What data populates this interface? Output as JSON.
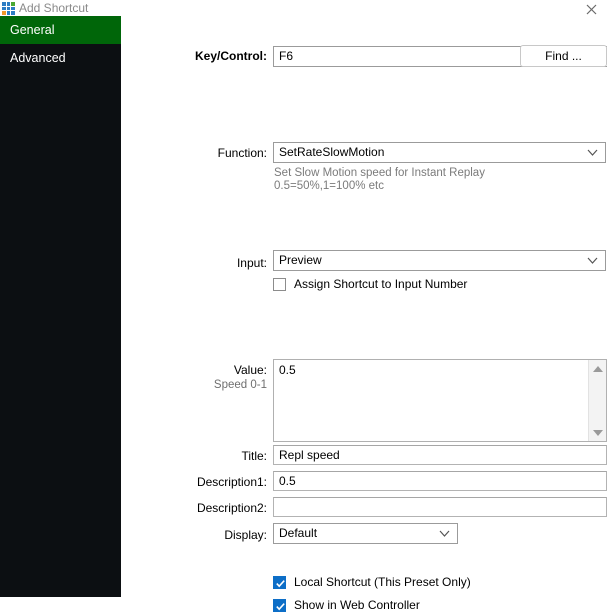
{
  "window": {
    "title": "Add Shortcut",
    "icon": "app-grid-icon",
    "close_label": "✕",
    "icon_colors": [
      "#2d7dc4",
      "#2d7dc4",
      "#4aa832",
      "#2d7dc4",
      "#2d7dc4",
      "#2d7dc4",
      "#f0982a",
      "#2d7dc4",
      "#2d7dc4"
    ]
  },
  "sidebar": {
    "items": [
      {
        "label": "General",
        "active": true
      },
      {
        "label": "Advanced",
        "active": false
      }
    ],
    "active_color": "#006609",
    "background": "#0c0f12"
  },
  "form": {
    "key_control": {
      "label": "Key/Control:",
      "value": "F6",
      "find_button": "Find ..."
    },
    "function": {
      "label": "Function:",
      "value": "SetRateSlowMotion",
      "description_line1": "Set Slow Motion speed for Instant Replay",
      "description_line2": "0.5=50%,1=100% etc"
    },
    "input": {
      "label": "Input:",
      "value": "Preview",
      "assign_checkbox_label": "Assign Shortcut to Input Number",
      "assign_checked": false
    },
    "value": {
      "label": "Value:",
      "sublabel": "Speed 0-1",
      "value": "0.5"
    },
    "title": {
      "label": "Title:",
      "value": "Repl speed"
    },
    "description1": {
      "label": "Description1:",
      "value": "0.5"
    },
    "description2": {
      "label": "Description2:",
      "value": ""
    },
    "display": {
      "label": "Display:",
      "value": "Default"
    },
    "options": [
      {
        "label": "Local Shortcut (This Preset Only)",
        "checked": true
      },
      {
        "label": "Show in Web Controller",
        "checked": true
      }
    ]
  },
  "colors": {
    "accent_blue": "#0d6ec7",
    "sidebar_green": "#006609",
    "muted_text": "#7b7b7b"
  }
}
